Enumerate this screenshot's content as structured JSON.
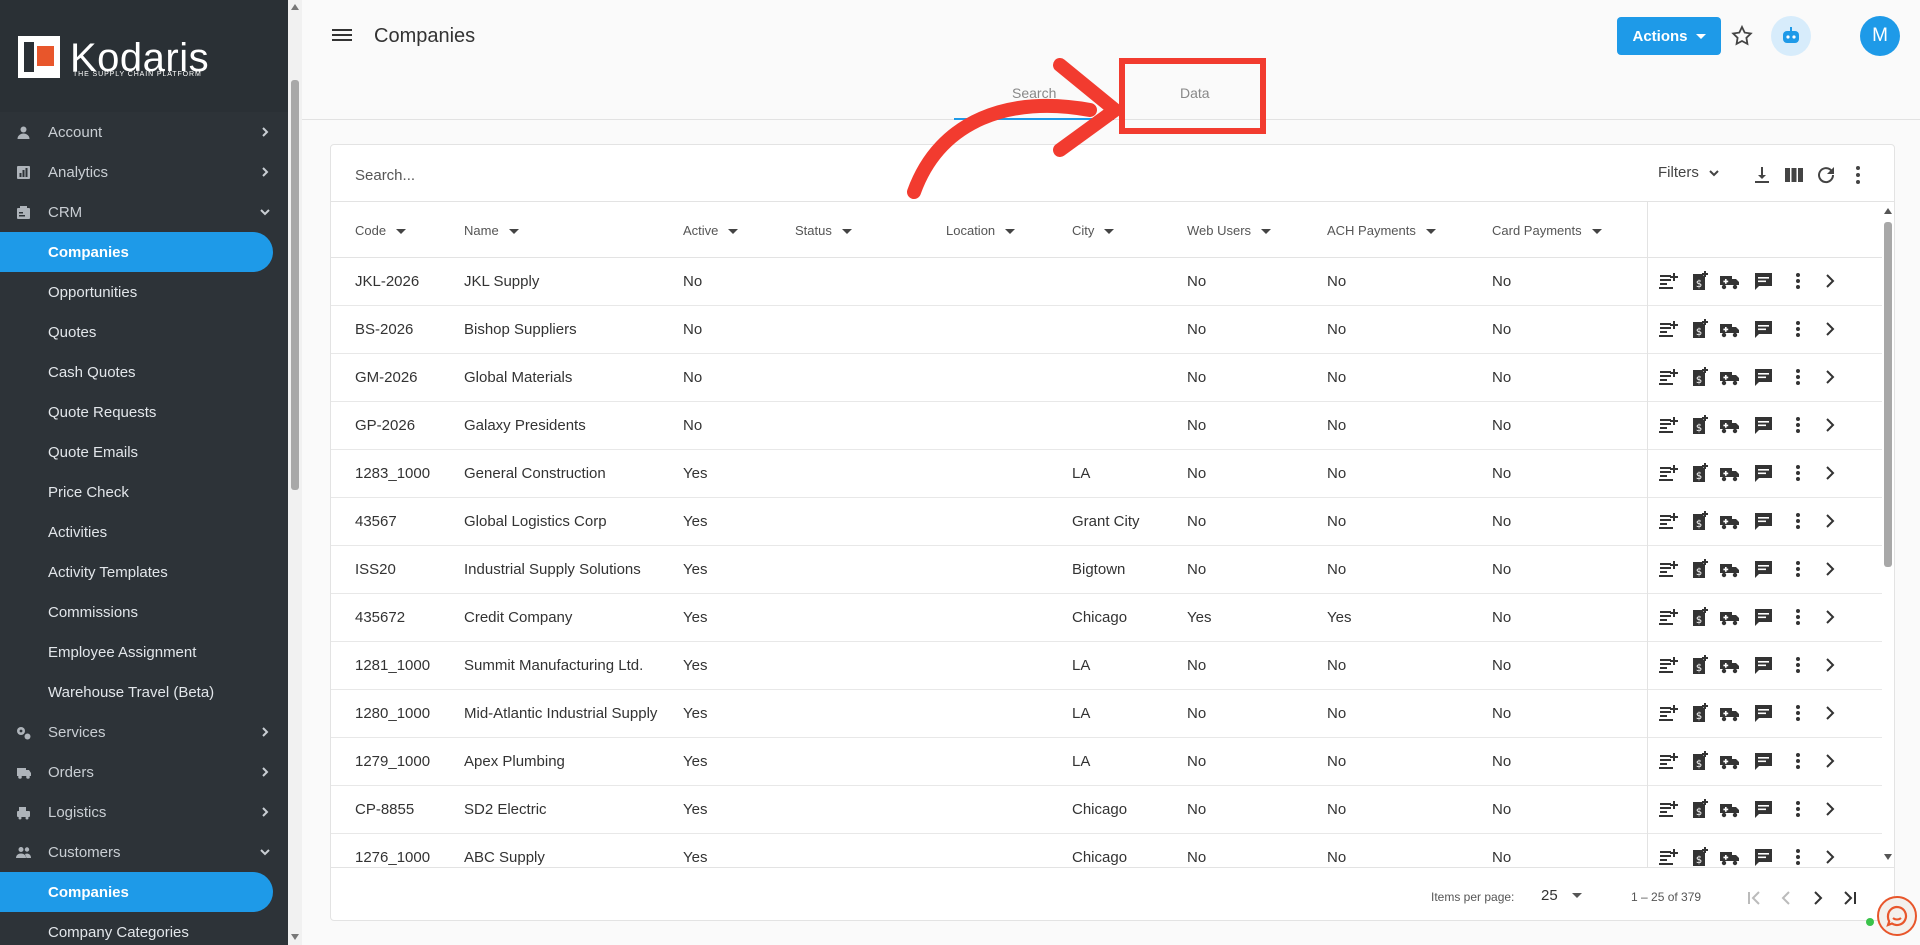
{
  "brand": {
    "name": "Kodaris",
    "tagline": "THE SUPPLY CHAIN PLATFORM"
  },
  "sidebar": {
    "items": [
      {
        "label": "Account",
        "icon": "person-icon",
        "expandable": true,
        "expanded": false
      },
      {
        "label": "Analytics",
        "icon": "analytics-icon",
        "expandable": true,
        "expanded": false
      },
      {
        "label": "CRM",
        "icon": "crm-icon",
        "expandable": true,
        "expanded": true
      },
      {
        "label": "Companies",
        "sub": true,
        "active": true
      },
      {
        "label": "Opportunities",
        "sub": true
      },
      {
        "label": "Quotes",
        "sub": true
      },
      {
        "label": "Cash Quotes",
        "sub": true
      },
      {
        "label": "Quote Requests",
        "sub": true
      },
      {
        "label": "Quote Emails",
        "sub": true
      },
      {
        "label": "Price Check",
        "sub": true
      },
      {
        "label": "Activities",
        "sub": true
      },
      {
        "label": "Activity Templates",
        "sub": true
      },
      {
        "label": "Commissions",
        "sub": true
      },
      {
        "label": "Employee Assignment",
        "sub": true
      },
      {
        "label": "Warehouse Travel (Beta)",
        "sub": true
      },
      {
        "label": "Services",
        "icon": "gears-icon",
        "expandable": true,
        "expanded": false
      },
      {
        "label": "Orders",
        "icon": "truck-icon",
        "expandable": true,
        "expanded": false
      },
      {
        "label": "Logistics",
        "icon": "logistics-icon",
        "expandable": true,
        "expanded": false
      },
      {
        "label": "Customers",
        "icon": "people-icon",
        "expandable": true,
        "expanded": true
      },
      {
        "label": "Companies",
        "sub": true,
        "active": true
      },
      {
        "label": "Company Categories",
        "sub": true
      }
    ]
  },
  "header": {
    "title": "Companies",
    "actions_label": "Actions",
    "avatar_initial": "M"
  },
  "tabs": [
    {
      "label": "Search",
      "active": true
    },
    {
      "label": "Data",
      "active": false
    }
  ],
  "table": {
    "search_placeholder": "Search...",
    "filters_label": "Filters",
    "columns": [
      "Code",
      "Name",
      "Active",
      "Status",
      "Location",
      "City",
      "Web Users",
      "ACH Payments",
      "Card Payments"
    ],
    "rows": [
      {
        "code": "JKL-2026",
        "name": "JKL Supply",
        "active": "No",
        "status": "",
        "location": "",
        "city": "",
        "web_users": "No",
        "ach": "No",
        "card": "No"
      },
      {
        "code": "BS-2026",
        "name": "Bishop Suppliers",
        "active": "No",
        "status": "",
        "location": "",
        "city": "",
        "web_users": "No",
        "ach": "No",
        "card": "No"
      },
      {
        "code": "GM-2026",
        "name": "Global Materials",
        "active": "No",
        "status": "",
        "location": "",
        "city": "",
        "web_users": "No",
        "ach": "No",
        "card": "No"
      },
      {
        "code": "GP-2026",
        "name": "Galaxy Presidents",
        "active": "No",
        "status": "",
        "location": "",
        "city": "",
        "web_users": "No",
        "ach": "No",
        "card": "No"
      },
      {
        "code": "1283_1000",
        "name": "General Construction",
        "active": "Yes",
        "status": "",
        "location": "",
        "city": "LA",
        "web_users": "No",
        "ach": "No",
        "card": "No"
      },
      {
        "code": "43567",
        "name": "Global Logistics Corp",
        "active": "Yes",
        "status": "",
        "location": "",
        "city": "Grant City",
        "web_users": "No",
        "ach": "No",
        "card": "No"
      },
      {
        "code": "ISS20",
        "name": "Industrial Supply Solutions",
        "active": "Yes",
        "status": "",
        "location": "",
        "city": "Bigtown",
        "web_users": "No",
        "ach": "No",
        "card": "No"
      },
      {
        "code": "435672",
        "name": "Credit Company",
        "active": "Yes",
        "status": "",
        "location": "",
        "city": "Chicago",
        "web_users": "Yes",
        "ach": "Yes",
        "card": "No"
      },
      {
        "code": "1281_1000",
        "name": "Summit Manufacturing Ltd.",
        "active": "Yes",
        "status": "",
        "location": "",
        "city": "LA",
        "web_users": "No",
        "ach": "No",
        "card": "No"
      },
      {
        "code": "1280_1000",
        "name": "Mid-Atlantic Industrial Supply",
        "active": "Yes",
        "status": "",
        "location": "",
        "city": "LA",
        "web_users": "No",
        "ach": "No",
        "card": "No"
      },
      {
        "code": "1279_1000",
        "name": "Apex Plumbing",
        "active": "Yes",
        "status": "",
        "location": "",
        "city": "LA",
        "web_users": "No",
        "ach": "No",
        "card": "No"
      },
      {
        "code": "CP-8855",
        "name": "SD2 Electric",
        "active": "Yes",
        "status": "",
        "location": "",
        "city": "Chicago",
        "web_users": "No",
        "ach": "No",
        "card": "No"
      },
      {
        "code": "1276_1000",
        "name": "ABC Supply",
        "active": "Yes",
        "status": "",
        "location": "",
        "city": "Chicago",
        "web_users": "No",
        "ach": "No",
        "card": "No"
      }
    ],
    "row_action_icons": [
      "new-note-icon",
      "new-quote-icon",
      "shipping-icon",
      "comment-icon",
      "more-vert-icon",
      "chevron-right-icon"
    ]
  },
  "pagination": {
    "items_per_page_label": "Items per page:",
    "items_per_page": "25",
    "range": "1 – 25 of 379"
  },
  "colors": {
    "accent": "#1e9ae8",
    "sidebar_bg": "#2d3338",
    "annotation_red": "#f23b2f"
  }
}
